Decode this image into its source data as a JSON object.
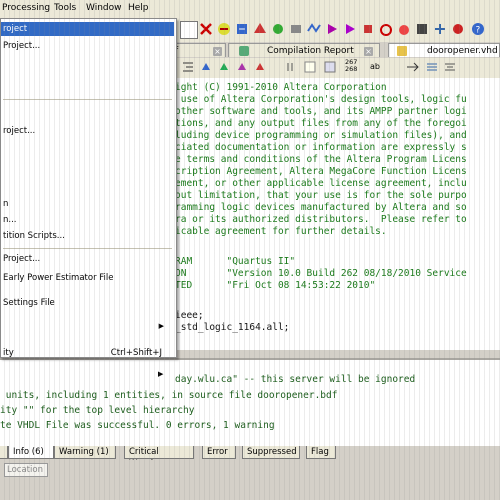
{
  "menubar": {
    "items": [
      "Processing",
      "Tools",
      "Window",
      "Help"
    ]
  },
  "toolbar": {
    "icons": [
      "delete-icon",
      "compile-icon",
      "analysis-icon",
      "synthesis-icon",
      "fitter-icon",
      "assembler-icon",
      "timing-icon",
      "simulate-icon",
      "play-icon",
      "stop-icon",
      "stopwatch-icon",
      "timer-icon",
      "chip-icon",
      "netlist-icon",
      "programmer-icon",
      "help-icon"
    ]
  },
  "tabs": {
    "left_fragment": "f",
    "compilation_report": "Compilation Report",
    "active_file": "dooropener.vhd"
  },
  "editor_toolbar": {
    "bit_label_top": "267",
    "bit_label_bottom": "268",
    "ab_label": "ab"
  },
  "editor": {
    "lines": [
      "ight (C) 1991-2010 Altera Corporation",
      " use of Altera Corporation's design tools, logic fu",
      "other software and tools, and its AMPP partner logi",
      "tions, and any output files from any of the foregoi",
      "luding device programming or simulation files), and",
      "ciated documentation or information are expressly s",
      "e terms and conditions of the Altera Program Licens",
      "cription Agreement, Altera MegaCore Function Licens",
      "ement, or other applicable license agreement, inclu",
      "out limitation, that your use is for the sole purpo",
      "ramming logic devices manufactured by Altera and so",
      "ra or its authorized distributors.  Please refer to",
      "icable agreement for further details."
    ],
    "meta_lines": [
      "RAM      \"Quartus II\"",
      "ON       \"Version 10.0 Build 262 08/18/2010 Service",
      "TED      \"Fri Oct 08 14:53:22 2010\""
    ],
    "code_lines": [
      "ieee;",
      "_std_logic_1164.all;"
    ]
  },
  "messages": {
    "lines": [
      "day.wlu.ca\" -- this server will be ignored",
      " units, including 1 entities, in source file dooropener.bdf",
      "ity \"\" for the top level hierarchy",
      "te VHDL File was successful. 0 errors, 1 warning"
    ]
  },
  "message_tabs": [
    "Info (6)",
    "Warning (1)",
    "Critical Warning",
    "Error",
    "Suppressed",
    "Flag"
  ],
  "location": {
    "placeholder": "Location"
  },
  "dropdown": {
    "items": [
      {
        "label": "roject",
        "highlighted": true
      },
      {
        "label": "Project..."
      },
      {
        "label": "roject..."
      },
      {
        "label": "n"
      },
      {
        "label": "n..."
      },
      {
        "label": "tition Scripts..."
      },
      {
        "label": "Project..."
      },
      {
        "label": "Early Power Estimator File"
      },
      {
        "label": "Settings File"
      },
      {
        "label": "ity",
        "shortcut": "Ctrl+Shift+J"
      }
    ]
  },
  "colors": {
    "menu_highlight": "#316ac5",
    "comment_green": "#1a7a1a"
  }
}
